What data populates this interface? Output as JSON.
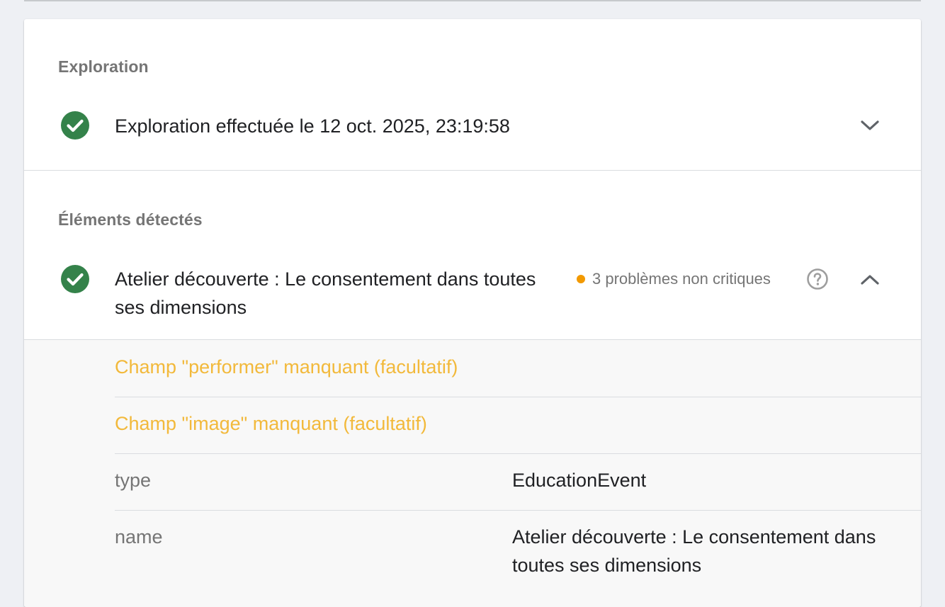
{
  "crawl": {
    "section_label": "Exploration",
    "status_text": "Exploration effectuée le 12 oct. 2025, 23:19:58"
  },
  "detected": {
    "section_label": "Éléments détectés",
    "item_title": "Atelier découverte : Le consentement dans toutes ses dimensions",
    "issues_label": "3 problèmes non critiques"
  },
  "warnings": [
    {
      "text": "Champ \"performer\" manquant (facultatif)"
    },
    {
      "text": "Champ \"image\" manquant (facultatif)"
    }
  ],
  "properties": [
    {
      "key": "type",
      "value": "EducationEvent"
    },
    {
      "key": "name",
      "value": "Atelier découverte : Le consentement dans toutes ses dimensions"
    }
  ],
  "colors": {
    "success_green": "#34824a",
    "warning_orange": "#f29900",
    "warning_text": "#f2b93b"
  },
  "icons": {
    "success": "check-circle-icon",
    "expand": "chevron-down-icon",
    "collapse": "chevron-up-icon",
    "help": "help-circle-icon"
  }
}
